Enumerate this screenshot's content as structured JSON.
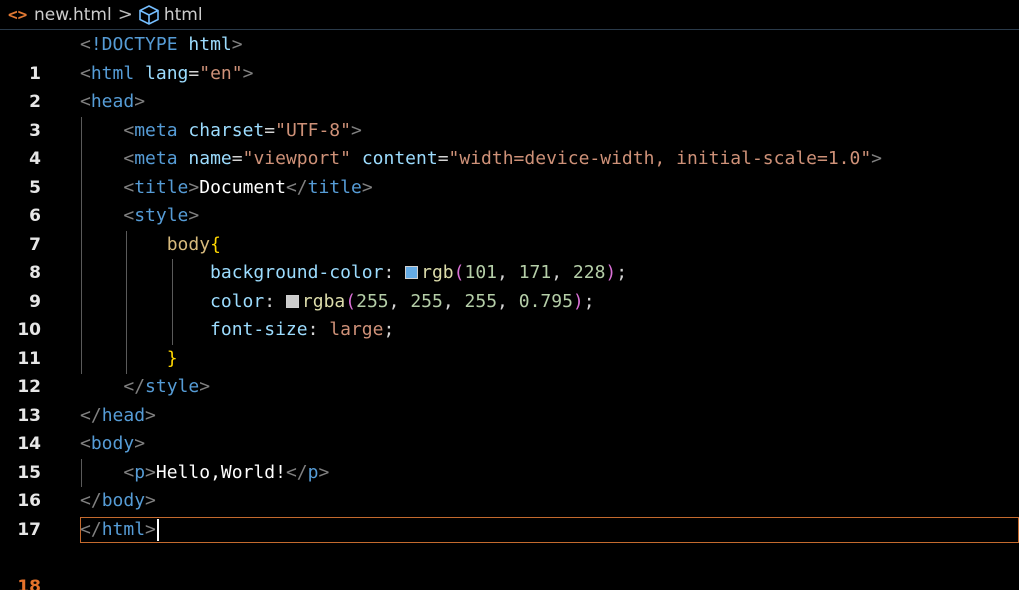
{
  "breadcrumb": {
    "html_icon": "<>",
    "file": "new.html",
    "separator": ">",
    "symbol_icon": "cube-icon",
    "symbol": "html"
  },
  "colors": {
    "background": "#000000",
    "current_line_number": "#e5722b",
    "current_line_border": "#c46a2e",
    "swatch_1": "rgb(101, 171, 228)",
    "swatch_2": "rgba(255, 255, 255, 0.795)"
  },
  "editor": {
    "current_line": 18,
    "lines": [
      {
        "n": "1"
      },
      {
        "n": "2"
      },
      {
        "n": "3"
      },
      {
        "n": "4"
      },
      {
        "n": "5"
      },
      {
        "n": "6"
      },
      {
        "n": "7"
      },
      {
        "n": "8"
      },
      {
        "n": "9"
      },
      {
        "n": "10"
      },
      {
        "n": "11"
      },
      {
        "n": "12"
      },
      {
        "n": "13"
      },
      {
        "n": "14"
      },
      {
        "n": "15"
      },
      {
        "n": "16"
      },
      {
        "n": "17"
      },
      {
        "n": "18"
      }
    ],
    "code": {
      "l1_doctype": "!DOCTYPE",
      "l1_html": "html",
      "l2_tag": "html",
      "l2_attr": "lang",
      "l2_val": "\"en\"",
      "l3_tag": "head",
      "l4_tag": "meta",
      "l4_attr": "charset",
      "l4_val": "\"UTF-8\"",
      "l5_tag": "meta",
      "l5_attr1": "name",
      "l5_val1": "\"viewport\"",
      "l5_attr2": "content",
      "l5_val2": "\"width=device-width, initial-scale=1.0\"",
      "l6_tag_open": "title",
      "l6_text": "Document",
      "l6_tag_close": "title",
      "l7_tag": "style",
      "l8_sel": "body",
      "l8_brace": "{",
      "l9_prop": "background-color",
      "l9_fn": "rgb",
      "l9_args": [
        "101",
        "171",
        "228"
      ],
      "l10_prop": "color",
      "l10_fn": "rgba",
      "l10_args": [
        "255",
        "255",
        "255",
        "0.795"
      ],
      "l11_prop": "font-size",
      "l11_val": "large",
      "l12_brace": "}",
      "l13_tag": "style",
      "l14_tag": "head",
      "l15_tag": "body",
      "l16_tag_open": "p",
      "l16_text": "Hello,World!",
      "l16_tag_close": "p",
      "l17_tag": "body",
      "l18_tag": "html"
    }
  }
}
